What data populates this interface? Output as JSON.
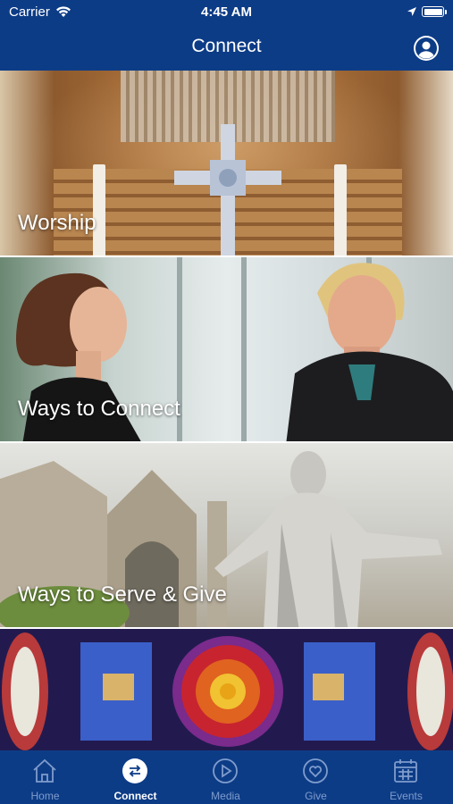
{
  "status_bar": {
    "carrier": "Carrier",
    "time": "4:45 AM"
  },
  "header": {
    "title": "Connect",
    "profile_icon": "profile-icon"
  },
  "tiles": [
    {
      "label": "Worship",
      "image": "church-altar-cross"
    },
    {
      "label": "Ways to Connect",
      "image": "two-women-talking"
    },
    {
      "label": "Ways to Serve & Give",
      "image": "christ-statue-church"
    },
    {
      "label": "",
      "image": "stained-glass-window"
    }
  ],
  "tab_bar": {
    "active": "Connect",
    "tabs": [
      {
        "label": "Home",
        "icon": "home-icon"
      },
      {
        "label": "Connect",
        "icon": "connect-arrows-icon"
      },
      {
        "label": "Media",
        "icon": "play-icon"
      },
      {
        "label": "Give",
        "icon": "heart-icon"
      },
      {
        "label": "Events",
        "icon": "calendar-icon"
      }
    ]
  },
  "colors": {
    "brand": "#0d3c86",
    "tab_inactive": "#7f9ccd",
    "text": "#ffffff"
  }
}
